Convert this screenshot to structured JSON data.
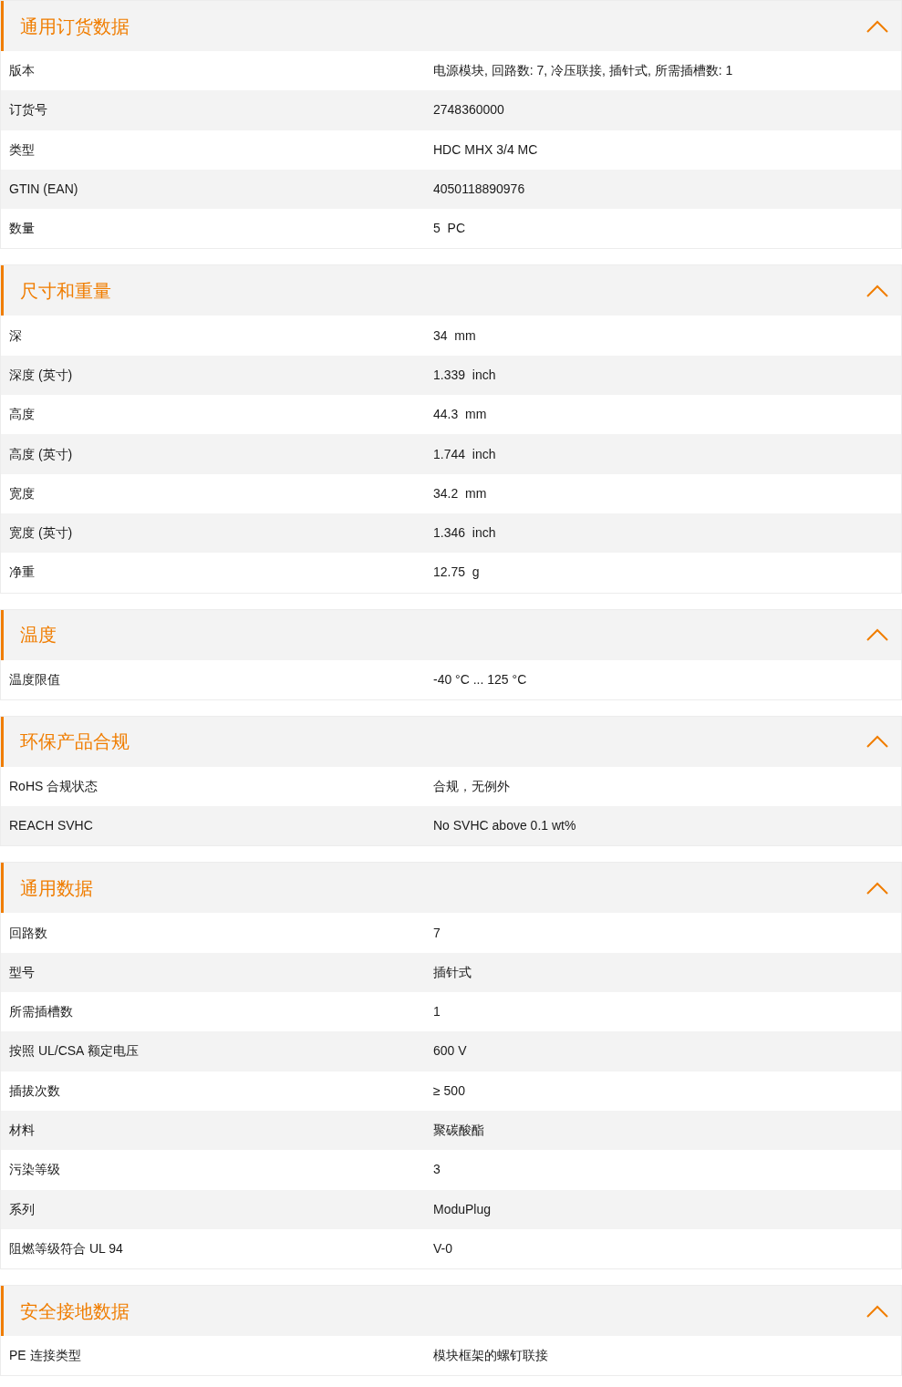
{
  "sections": [
    {
      "title": "通用订货数据",
      "expanded": true,
      "rows": [
        {
          "label": "版本",
          "value": "电源模块, 回路数: 7, 冷压联接, 插针式, 所需插槽数: 1"
        },
        {
          "label": "订货号",
          "value": "2748360000"
        },
        {
          "label": "类型",
          "value": "HDC MHX 3/4 MC"
        },
        {
          "label": "GTIN (EAN)",
          "value": "4050118890976"
        },
        {
          "label": "数量",
          "value": "5  PC"
        }
      ]
    },
    {
      "title": "尺寸和重量",
      "expanded": true,
      "rows": [
        {
          "label": "深",
          "value": "34  mm"
        },
        {
          "label": "深度 (英寸)",
          "value": "1.339  inch"
        },
        {
          "label": "高度",
          "value": "44.3  mm"
        },
        {
          "label": "高度 (英寸)",
          "value": "1.744  inch"
        },
        {
          "label": "宽度",
          "value": "34.2  mm"
        },
        {
          "label": "宽度 (英寸)",
          "value": "1.346  inch"
        },
        {
          "label": "净重",
          "value": "12.75  g"
        }
      ]
    },
    {
      "title": "温度",
      "expanded": true,
      "rows": [
        {
          "label": "温度限值",
          "value": "-40 °C ... 125 °C"
        }
      ]
    },
    {
      "title": "环保产品合规",
      "expanded": true,
      "rows": [
        {
          "label": "RoHS 合规状态",
          "value": "合规，无例外"
        },
        {
          "label": "REACH SVHC",
          "value": "No SVHC above 0.1 wt%"
        }
      ]
    },
    {
      "title": "通用数据",
      "expanded": true,
      "rows": [
        {
          "label": "回路数",
          "value": "7"
        },
        {
          "label": "型号",
          "value": "插针式"
        },
        {
          "label": "所需插槽数",
          "value": "1"
        },
        {
          "label": "按照 UL/CSA 额定电压",
          "value": "600 V"
        },
        {
          "label": "插拔次数",
          "value": "≥ 500"
        },
        {
          "label": "材料",
          "value": "聚碳酸酯"
        },
        {
          "label": "污染等级",
          "value": "3"
        },
        {
          "label": "系列",
          "value": "ModuPlug"
        },
        {
          "label": "阻燃等级符合 UL 94",
          "value": "V-0"
        }
      ]
    },
    {
      "title": "安全接地数据",
      "expanded": true,
      "rows": [
        {
          "label": "PE 连接类型",
          "value": "模块框架的螺钉联接"
        }
      ]
    }
  ]
}
